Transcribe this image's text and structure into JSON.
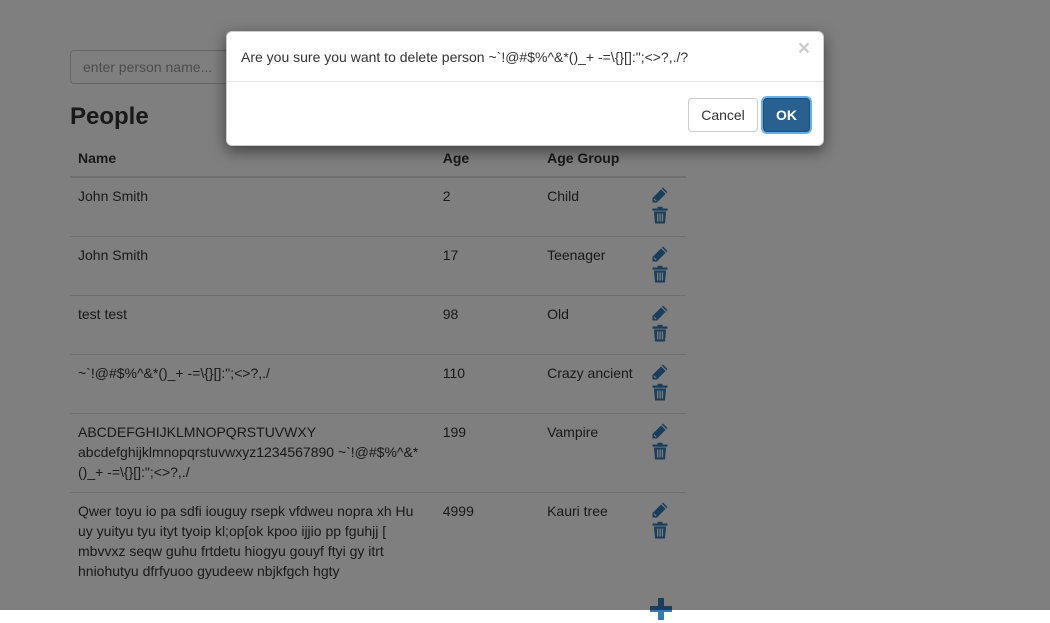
{
  "search": {
    "placeholder": "enter person name..."
  },
  "page": {
    "title": "People"
  },
  "table": {
    "headers": {
      "name": "Name",
      "age": "Age",
      "age_group": "Age Group"
    },
    "rows": [
      {
        "name": "John Smith",
        "age": "2",
        "group": "Child"
      },
      {
        "name": "John Smith",
        "age": "17",
        "group": "Teenager"
      },
      {
        "name": "test test",
        "age": "98",
        "group": "Old"
      },
      {
        "name": "~`!@#$%^&*()_+ -=\\{}[]:\";<>?,./",
        "age": "110",
        "group": "Crazy ancient"
      },
      {
        "name": "ABCDEFGHIJKLMNOPQRSTUVWXY abcdefghijklmnopqrstuvwxyz1234567890 ~`!@#$%^&*()_+ -=\\{}[]:\";<>?,./",
        "age": "199",
        "group": "Vampire"
      },
      {
        "name": "Qwer toyu io pa sdfi iouguy rsepk vfdweu nopra xh Hu uy yuityu tyu ityt tyoip kl;op[ok kpoo ijjio pp fguhjj [ mbvvxz seqw guhu frtdetu hiogyu gouyf ftyi gy itrt hniohutyu dfrfyuoo gyudeew nbjkfgch hgty",
        "age": "4999",
        "group": "Kauri tree"
      }
    ]
  },
  "icons": {
    "edit": "pencil-icon",
    "delete": "trash-icon",
    "add": "plus-icon"
  },
  "colors": {
    "icon": "#337ab7",
    "primary": "#286090",
    "backdrop": "rgba(0,0,0,0.5)"
  },
  "modal": {
    "message": "Are you sure you want to delete person ~`!@#$%^&*()_+ -=\\{}[]:\";<>?,./?",
    "close": "×",
    "cancel_label": "Cancel",
    "ok_label": "OK"
  }
}
